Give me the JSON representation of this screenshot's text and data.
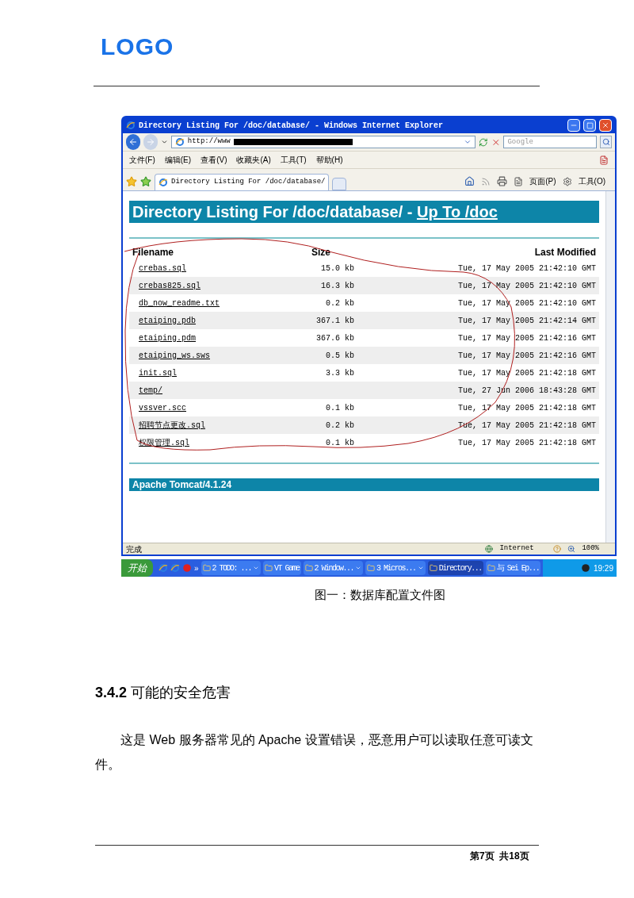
{
  "document": {
    "logo": "LOGO",
    "caption": "图一：数据库配置文件图",
    "heading": "**3.4.2** 可能的安全危害",
    "paragraph": "这是 Web 服务器常见的 Apache 设置错误，恶意用户可以读取任意可读文件。",
    "page_footer": "第7页  共18页"
  },
  "window": {
    "title": "Directory Listing For /doc/database/ - Windows Internet Explorer",
    "address": "http://www",
    "search_placeholder": "Google",
    "menu": [
      "文件(F)",
      "编辑(E)",
      "查看(V)",
      "收藏夹(A)",
      "工具(T)",
      "帮助(H)"
    ],
    "tab": "Directory Listing For /doc/database/",
    "toolbar": [
      "页面(P)",
      "工具(O)"
    ],
    "page": {
      "title": "Directory Listing For /doc/database/ - ",
      "up_link": "Up To /doc",
      "columns": [
        "Filename",
        "Size",
        "Last Modified"
      ],
      "rows": [
        {
          "name": "crebas.sql",
          "size": "15.0 kb",
          "modified": "Tue, 17 May 2005 21:42:10 GMT"
        },
        {
          "name": "crebas825.sql",
          "size": "16.3 kb",
          "modified": "Tue, 17 May 2005 21:42:10 GMT"
        },
        {
          "name": "db_now_readme.txt",
          "size": "0.2 kb",
          "modified": "Tue, 17 May 2005 21:42:10 GMT"
        },
        {
          "name": "etaiping.pdb",
          "size": "367.1 kb",
          "modified": "Tue, 17 May 2005 21:42:14 GMT"
        },
        {
          "name": "etaiping.pdm",
          "size": "367.6 kb",
          "modified": "Tue, 17 May 2005 21:42:16 GMT"
        },
        {
          "name": "etaiping_ws.sws",
          "size": "0.5 kb",
          "modified": "Tue, 17 May 2005 21:42:16 GMT"
        },
        {
          "name": "init.sql",
          "size": "3.3 kb",
          "modified": "Tue, 17 May 2005 21:42:18 GMT"
        },
        {
          "name": "temp/",
          "modified": "Tue, 27 Jun 2006 18:43:28 GMT"
        },
        {
          "name": "vssver.scc",
          "size": "0.1 kb",
          "modified": "Tue, 17 May 2005 21:42:18 GMT"
        },
        {
          "name": "招聘节点更改.sql",
          "size": "0.2 kb",
          "modified": "Tue, 17 May 2005 21:42:18 GMT"
        },
        {
          "name": "权限管理.sql",
          "size": "0.1 kb",
          "modified": "Tue, 17 May 2005 21:42:18 GMT"
        }
      ],
      "footer": "Apache Tomcat/4.1.24"
    },
    "status": {
      "text": "完成",
      "zone": "Internet",
      "zoom": "100%"
    }
  },
  "taskbar": {
    "start": "开始",
    "more": "»",
    "clock": "19:29",
    "items": [
      {
        "label": "2 TODO: ...",
        "selected": false,
        "grouped": true
      },
      {
        "label": "VT Game",
        "selected": false,
        "grouped": false
      },
      {
        "label": "2 Window...",
        "selected": false,
        "grouped": true
      },
      {
        "label": "3 Micros...",
        "selected": false,
        "grouped": true
      },
      {
        "label": "Directory...",
        "selected": true,
        "grouped": false
      },
      {
        "label": "与 Sei Ep...",
        "selected": false,
        "grouped": false
      }
    ]
  }
}
